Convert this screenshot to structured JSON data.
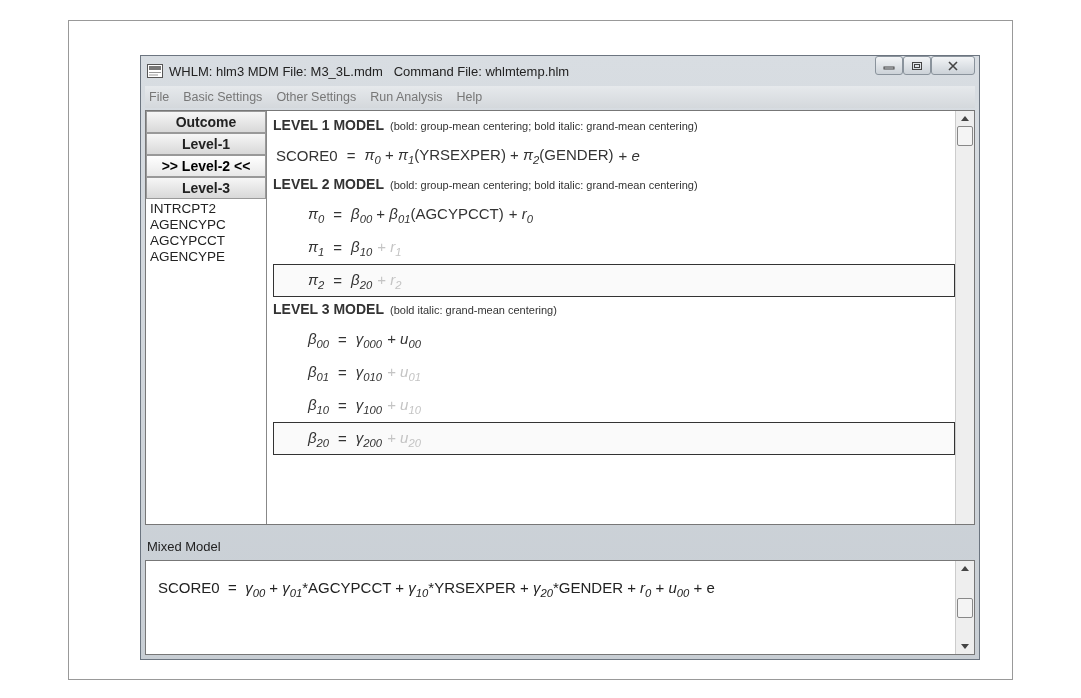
{
  "window": {
    "title": "WHLM: hlm3 MDM File: M3_3L.mdm   Command File: whlmtemp.hlm"
  },
  "menu": [
    "File",
    "Basic Settings",
    "Other Settings",
    "Run Analysis",
    "Help"
  ],
  "level_buttons": [
    {
      "label": "Outcome",
      "selected": false
    },
    {
      "label": "Level-1",
      "selected": false
    },
    {
      "label": ">> Level-2 <<",
      "selected": true
    },
    {
      "label": "Level-3",
      "selected": false
    }
  ],
  "variables": [
    "INTRCPT2",
    "AGENCYPC",
    "AGCYPCCT",
    "AGENCYPE"
  ],
  "models": [
    {
      "heading": "LEVEL 1 MODEL",
      "note": "(bold: group-mean centering; bold italic: grand-mean centering)",
      "equations": [
        {
          "lhs": "SCORE0",
          "sign": "=",
          "rhs": "*π*$_{0}$ + *π*$_{1}$(YRSEXPER) + *π*$_{2}$(GENDER)",
          "random": "+ *e*",
          "random_on": true,
          "selected": false
        }
      ]
    },
    {
      "heading": "LEVEL 2 MODEL",
      "note": "(bold: group-mean centering; bold italic: grand-mean centering)",
      "equations": [
        {
          "lhs": "*π*$_{0}$",
          "sign": "=",
          "rhs": "*β*$_{00}$ + *β*$_{01}$(AGCYPCCT)",
          "random": "+ *r*$_{0}$",
          "random_on": true,
          "selected": false
        },
        {
          "lhs": "*π*$_{1}$",
          "sign": "=",
          "rhs": "*β*$_{10}$",
          "random": "+ *r*$_{1}$",
          "random_on": false,
          "selected": false
        },
        {
          "lhs": "*π*$_{2}$",
          "sign": "=",
          "rhs": "*β*$_{20}$",
          "random": "+ *r*$_{2}$",
          "random_on": false,
          "selected": true
        }
      ]
    },
    {
      "heading": "LEVEL 3 MODEL",
      "note": "(bold italic: grand-mean centering)",
      "equations": [
        {
          "lhs": "*β*$_{00}$",
          "sign": "=",
          "rhs": "*γ*$_{000}$",
          "random": "+ *u*$_{00}$",
          "random_on": true,
          "selected": false
        },
        {
          "lhs": "*β*$_{01}$",
          "sign": "=",
          "rhs": "*γ*$_{010}$",
          "random": "+ *u*$_{01}$",
          "random_on": false,
          "selected": false
        },
        {
          "lhs": "*β*$_{10}$",
          "sign": "=",
          "rhs": "*γ*$_{100}$",
          "random": "+ *u*$_{10}$",
          "random_on": false,
          "selected": false
        },
        {
          "lhs": "*β*$_{20}$",
          "sign": "=",
          "rhs": "*γ*$_{200}$",
          "random": "+ *u*$_{20}$",
          "random_on": false,
          "selected": true
        }
      ]
    }
  ],
  "mixed_model": {
    "label": "Mixed Model",
    "equation": "SCORE0  =  *γ*$_{00}$ + *γ*$_{01}$*AGCYPCCT + *γ*$_{10}$*YRSEXPER + *γ*$_{20}$*GENDER + *r*$_{0}$ + *u*$_{00}$ + e"
  }
}
